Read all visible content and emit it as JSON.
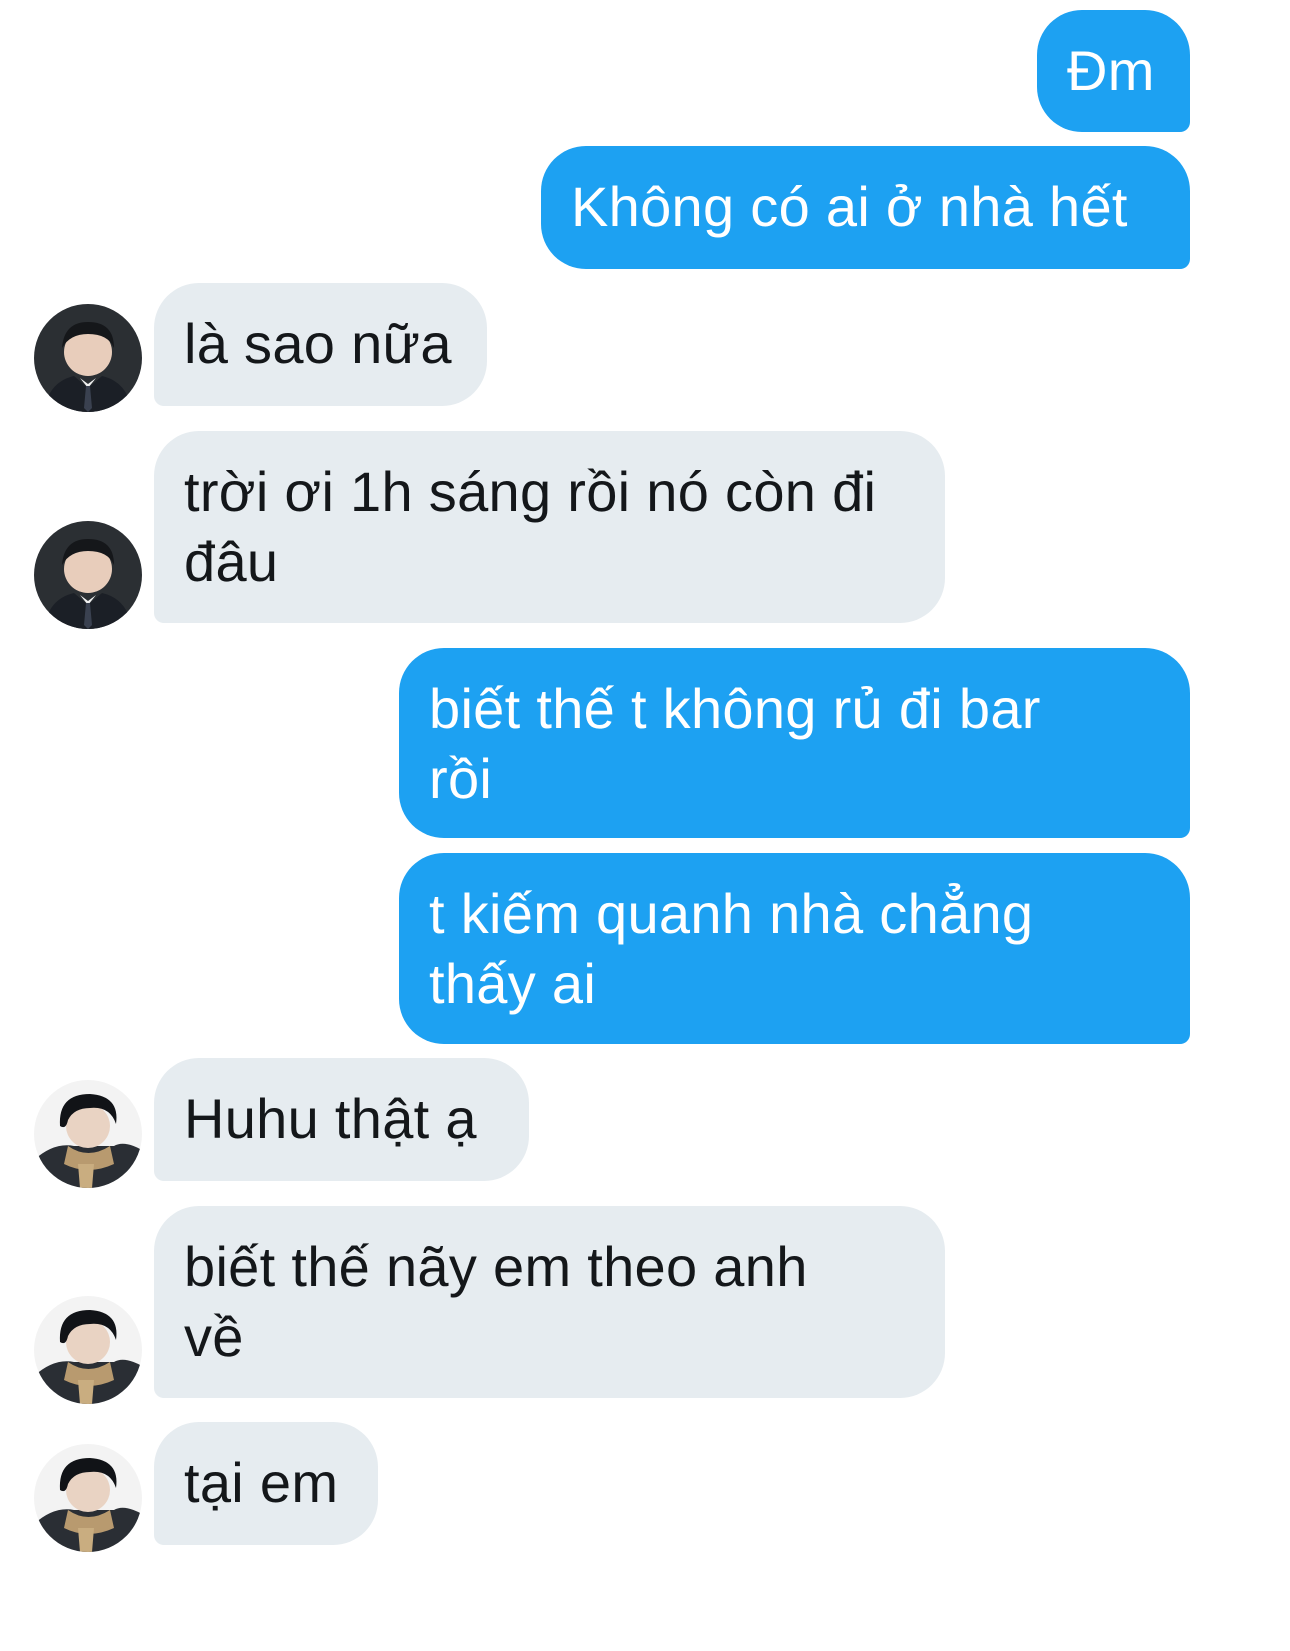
{
  "messages": [
    {
      "id": "m1",
      "sender": "me",
      "lines": [
        "Đm"
      ]
    },
    {
      "id": "m2",
      "sender": "me",
      "lines": [
        "Không có ai ở nhà hết"
      ]
    },
    {
      "id": "m3",
      "sender": "contact-a",
      "lines": [
        "là sao nữa"
      ]
    },
    {
      "id": "m4",
      "sender": "contact-a",
      "lines": [
        "trời ơi 1h sáng rồi nó còn đi",
        "đâu"
      ]
    },
    {
      "id": "m5",
      "sender": "me",
      "lines": [
        "biết thế t không rủ đi bar",
        "rồi"
      ]
    },
    {
      "id": "m6",
      "sender": "me",
      "lines": [
        "t kiếm quanh nhà chẳng",
        "thấy ai"
      ]
    },
    {
      "id": "m7",
      "sender": "contact-b",
      "lines": [
        "Huhu thật ạ"
      ]
    },
    {
      "id": "m8",
      "sender": "contact-b",
      "lines": [
        "biết thế nãy em theo anh",
        "về"
      ]
    },
    {
      "id": "m9",
      "sender": "contact-b",
      "lines": [
        "tại em"
      ]
    }
  ],
  "colors": {
    "outgoing_bubble": "#1da1f2",
    "outgoing_text": "#ffffff",
    "incoming_bubble": "#e6ecf0",
    "incoming_text": "#14171a",
    "background": "#ffffff"
  },
  "avatars": {
    "contact-a": "avatar-boy-in-suit-icon",
    "contact-b": "avatar-boy-in-scarf-icon"
  }
}
